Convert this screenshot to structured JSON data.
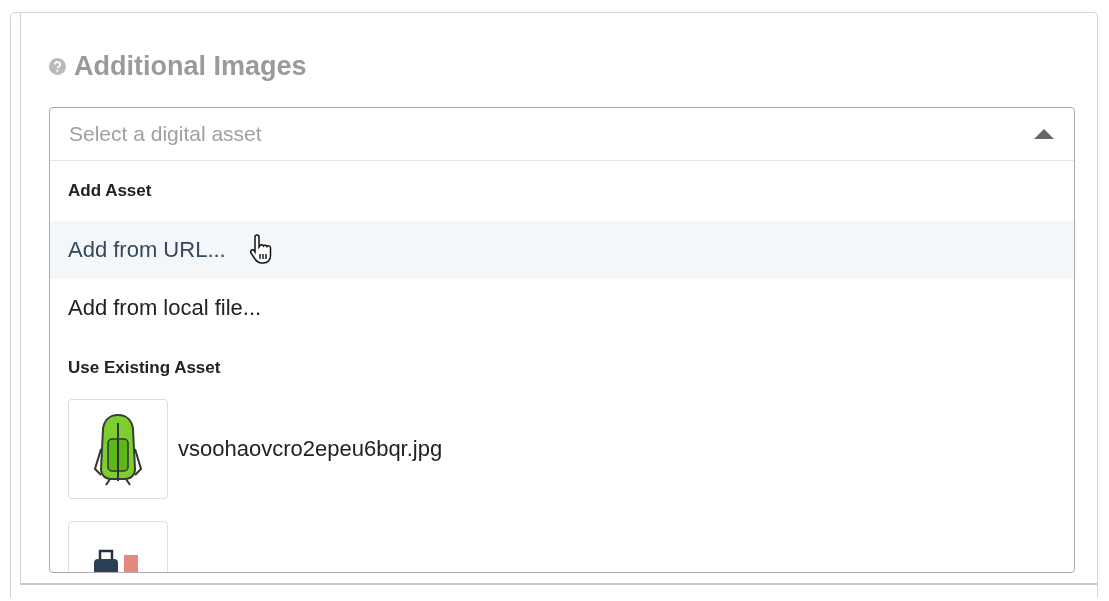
{
  "section": {
    "title": "Additional Images"
  },
  "asset_dropdown": {
    "placeholder": "Select a digital asset",
    "expanded": true,
    "groups": [
      {
        "label": "Add Asset",
        "items": [
          {
            "label": "Add from URL...",
            "highlighted": true
          },
          {
            "label": "Add from local file...",
            "highlighted": false
          }
        ]
      },
      {
        "label": "Use Existing Asset",
        "assets": [
          {
            "kind": "backpack",
            "filename": "vsoohaovcro2epeu6bqr.jpg"
          },
          {
            "kind": "luggage"
          }
        ]
      }
    ]
  }
}
